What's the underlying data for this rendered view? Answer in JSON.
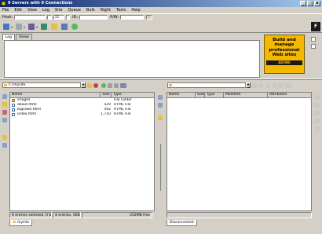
{
  "window": {
    "title": "0 Servers with 0 Connections",
    "min": "_",
    "max": "□",
    "close": "x"
  },
  "menu": [
    "File",
    "Edit",
    "View",
    "Log",
    "Site",
    "Queue",
    "Bulk",
    "Right",
    "Tools",
    "Help"
  ],
  "connect": {
    "host_label": "Host:",
    "host_value": "",
    "port_value": "21",
    "id_label": "ID:",
    "id_value": "",
    "pw_label": "P/W:",
    "pw_value": ""
  },
  "log_tabs": [
    "Log",
    "Views"
  ],
  "ad": {
    "line1": "Build and",
    "line2": "manage",
    "line3": "professional",
    "line4": "Web sites",
    "strip": "ADOBE DREAMWEAVER"
  },
  "left": {
    "path": "C:\\mysite",
    "columns": [
      "Name",
      "Size",
      "Type"
    ],
    "files": [
      {
        "icon": "folder-icon",
        "name": "images",
        "size": "",
        "type": "File Folder"
      },
      {
        "icon": "html-file-icon",
        "name": "about.html",
        "size": "529",
        "type": "HTML File"
      },
      {
        "icon": "html-file-icon",
        "name": "bigcows.html",
        "size": "592",
        "type": "HTML File"
      },
      {
        "icon": "html-file-icon",
        "name": "index.html",
        "size": "1,710",
        "type": "HTML File"
      }
    ],
    "status": [
      "0 entries selected, 0 bytes",
      "4 entries, 3KB",
      "252MB free"
    ],
    "tab": "mysite"
  },
  "right": {
    "path": "",
    "columns": [
      "Name",
      "Size",
      "Type",
      "Modified",
      "Attributes"
    ],
    "tab": "Disconnected"
  }
}
